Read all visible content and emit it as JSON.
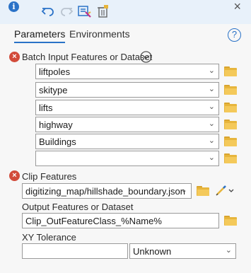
{
  "toolbar": {
    "info_icon_glyph": "i",
    "close_glyph": "×"
  },
  "tabs": {
    "parameters": "Parameters",
    "environments": "Environments",
    "help_glyph": "?"
  },
  "batch_input": {
    "label": "Batch Input Features or Dataset",
    "rows": [
      "liftpoles",
      "skitype",
      "lifts",
      "highway",
      "Buildings",
      ""
    ]
  },
  "clip_features": {
    "label": "Clip Features",
    "value": "digitizing_map/hillshade_boundary.json"
  },
  "output": {
    "label": "Output Features or Dataset",
    "value": "Clip_OutFeatureClass_%Name%"
  },
  "xy_tolerance": {
    "label": "XY Tolerance",
    "value": "",
    "unit": "Unknown"
  },
  "colors": {
    "accent": "#2a72c7",
    "error": "#d24b3a",
    "folder": "#e7b53c",
    "header_bg": "#e8f1fa"
  }
}
